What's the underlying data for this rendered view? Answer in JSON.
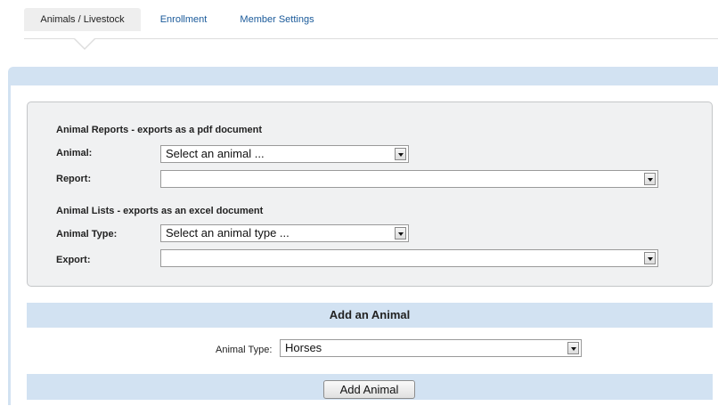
{
  "tabs": [
    {
      "label": "Animals / Livestock"
    },
    {
      "label": "Enrollment"
    },
    {
      "label": "Member Settings"
    }
  ],
  "reports": {
    "heading": "Animal Reports - exports as a pdf document",
    "animal_label": "Animal:",
    "animal_value": "Select an animal ...",
    "report_label": "Report:",
    "report_value": ""
  },
  "lists": {
    "heading": "Animal Lists - exports as an excel document",
    "type_label": "Animal Type:",
    "type_value": "Select an animal type ...",
    "export_label": "Export:",
    "export_value": ""
  },
  "add_animal": {
    "title": "Add an Animal",
    "type_label": "Animal Type:",
    "type_value": "Horses",
    "button_label": "Add Animal"
  },
  "colors": {
    "panel_blue": "#d2e2f2",
    "tab_link": "#1a5a9a",
    "box_background": "#f0f1f2"
  }
}
